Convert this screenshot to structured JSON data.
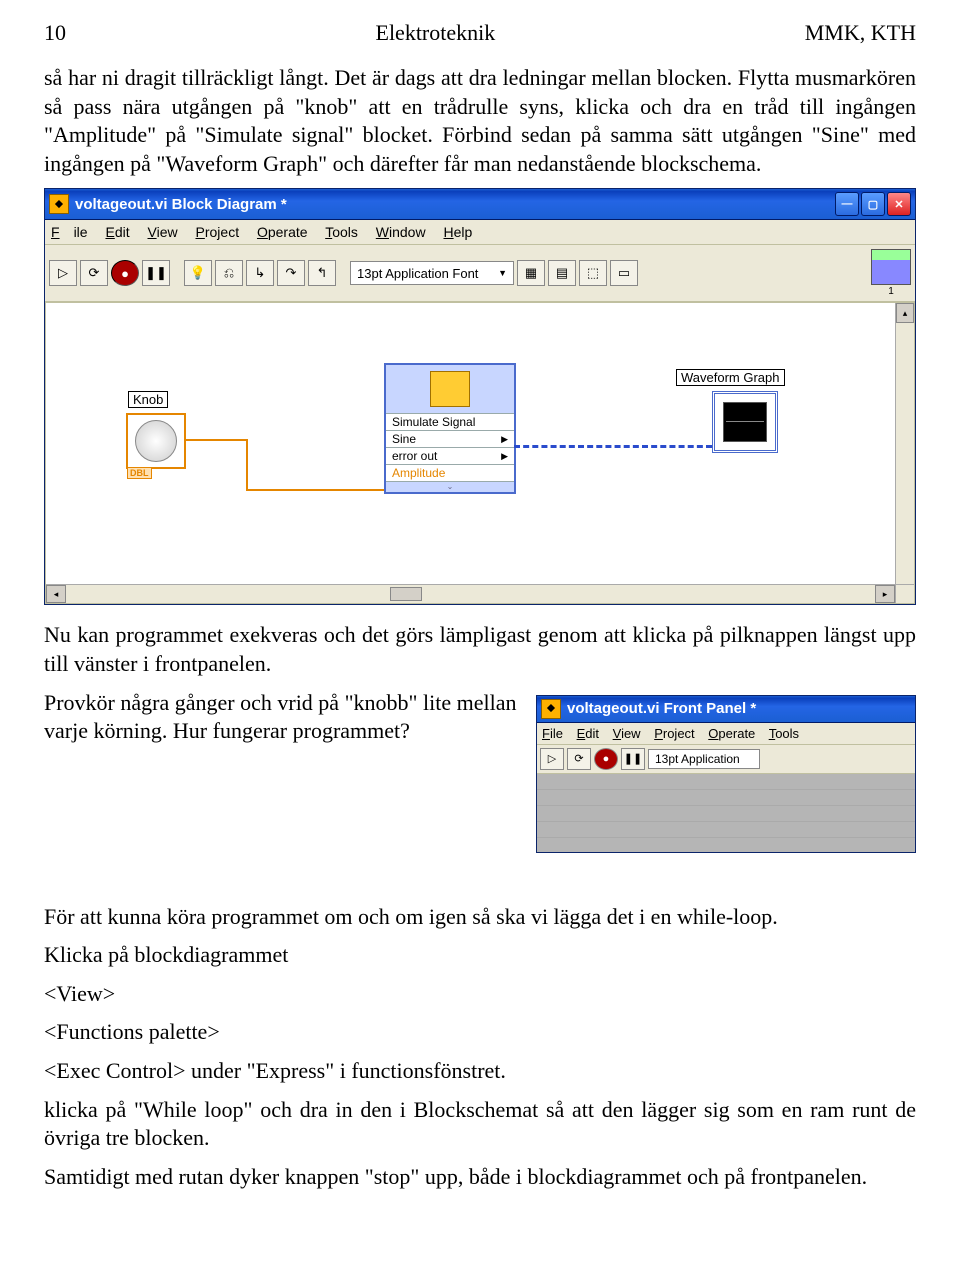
{
  "header": {
    "left": "10",
    "center": "Elektroteknik",
    "right": "MMK, KTH"
  },
  "para1": "så har ni dragit tillräckligt långt. Det är dags att dra ledningar mellan blocken. Flytta musmarkören så pass nära utgången på \"knob\" att en trådrulle syns, klicka och dra en tråd till ingången \"Amplitude\" på \"Simulate signal\" blocket. Förbind sedan på samma sätt utgången \"Sine\" med ingången på \"Waveform Graph\" och därefter får man nedanstående blockschema.",
  "win1": {
    "title": "voltageout.vi Block Diagram *",
    "menu": {
      "file": "File",
      "edit": "Edit",
      "view": "View",
      "project": "Project",
      "operate": "Operate",
      "tools": "Tools",
      "window": "Window",
      "help": "Help"
    },
    "font": "13pt Application Font",
    "vinum": "1",
    "knob_label": "Knob",
    "knob_dbl": "DBL",
    "sim": {
      "title": "Simulate Signal",
      "sine": "Sine",
      "err": "error out",
      "amp": "Amplitude"
    },
    "wave_label": "Waveform Graph"
  },
  "para2": "Nu kan programmet exekveras och det görs lämpligast genom att klicka på pilknappen längst upp till vänster i frontpanelen.",
  "para3": "Provkör några gånger och vrid på \"knobb\" lite mellan varje körning. Hur fungerar programmet?",
  "win2": {
    "title": "voltageout.vi Front Panel *",
    "menu": {
      "file": "File",
      "edit": "Edit",
      "view": "View",
      "project": "Project",
      "operate": "Operate",
      "tools": "Tools"
    },
    "font": "13pt Application"
  },
  "para4": "För att kunna köra programmet om och om igen så ska vi lägga det i en while-loop.",
  "para5": "Klicka på blockdiagrammet",
  "m_view": "<View>",
  "m_func": "<Functions palette>",
  "m_exec": "<Exec Control> under \"Express\" i functionsfönstret.",
  "m_while": "klicka på \"While loop\" och dra in den i  Blockschemat så att den lägger sig som en ram runt de övriga tre blocken.",
  "para6": "Samtidigt med rutan dyker knappen \"stop\" upp, både i blockdiagrammet och på frontpanelen."
}
